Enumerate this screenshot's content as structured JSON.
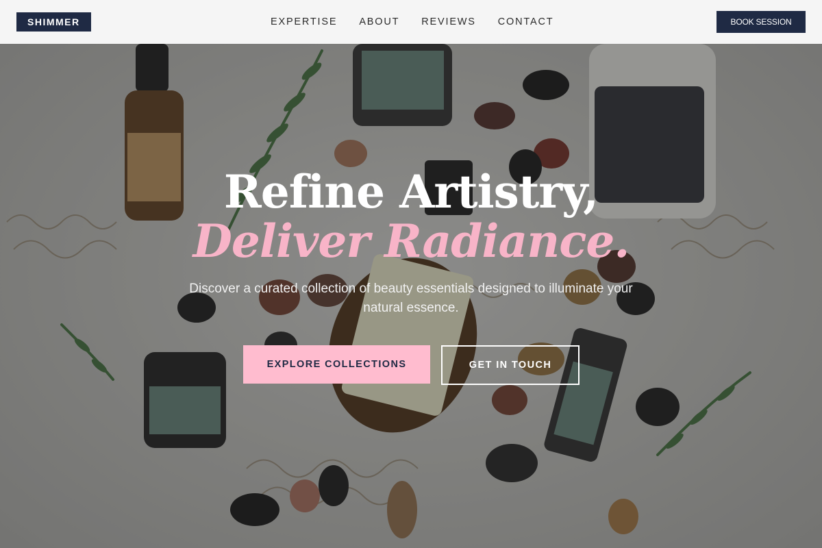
{
  "brand": {
    "logo_text": "SHIMMER"
  },
  "nav": {
    "items": [
      "EXPERTISE",
      "ABOUT",
      "REVIEWS",
      "CONTACT"
    ]
  },
  "header": {
    "cta_label": "BOOK SESSION"
  },
  "hero": {
    "headline_line1": "Refine Artistry,",
    "headline_line2": "Deliver Radiance.",
    "subtitle": "Discover a curated collection of beauty essentials designed to illuminate your natural essence.",
    "primary_button": "EXPLORE COLLECTIONS",
    "secondary_button": "GET IN TOUCH"
  },
  "colors": {
    "navy": "#1f2a44",
    "accent_pink": "#ffbccf",
    "headline_pink": "#f8b4c8",
    "nav_bg": "#f5f5f5"
  }
}
